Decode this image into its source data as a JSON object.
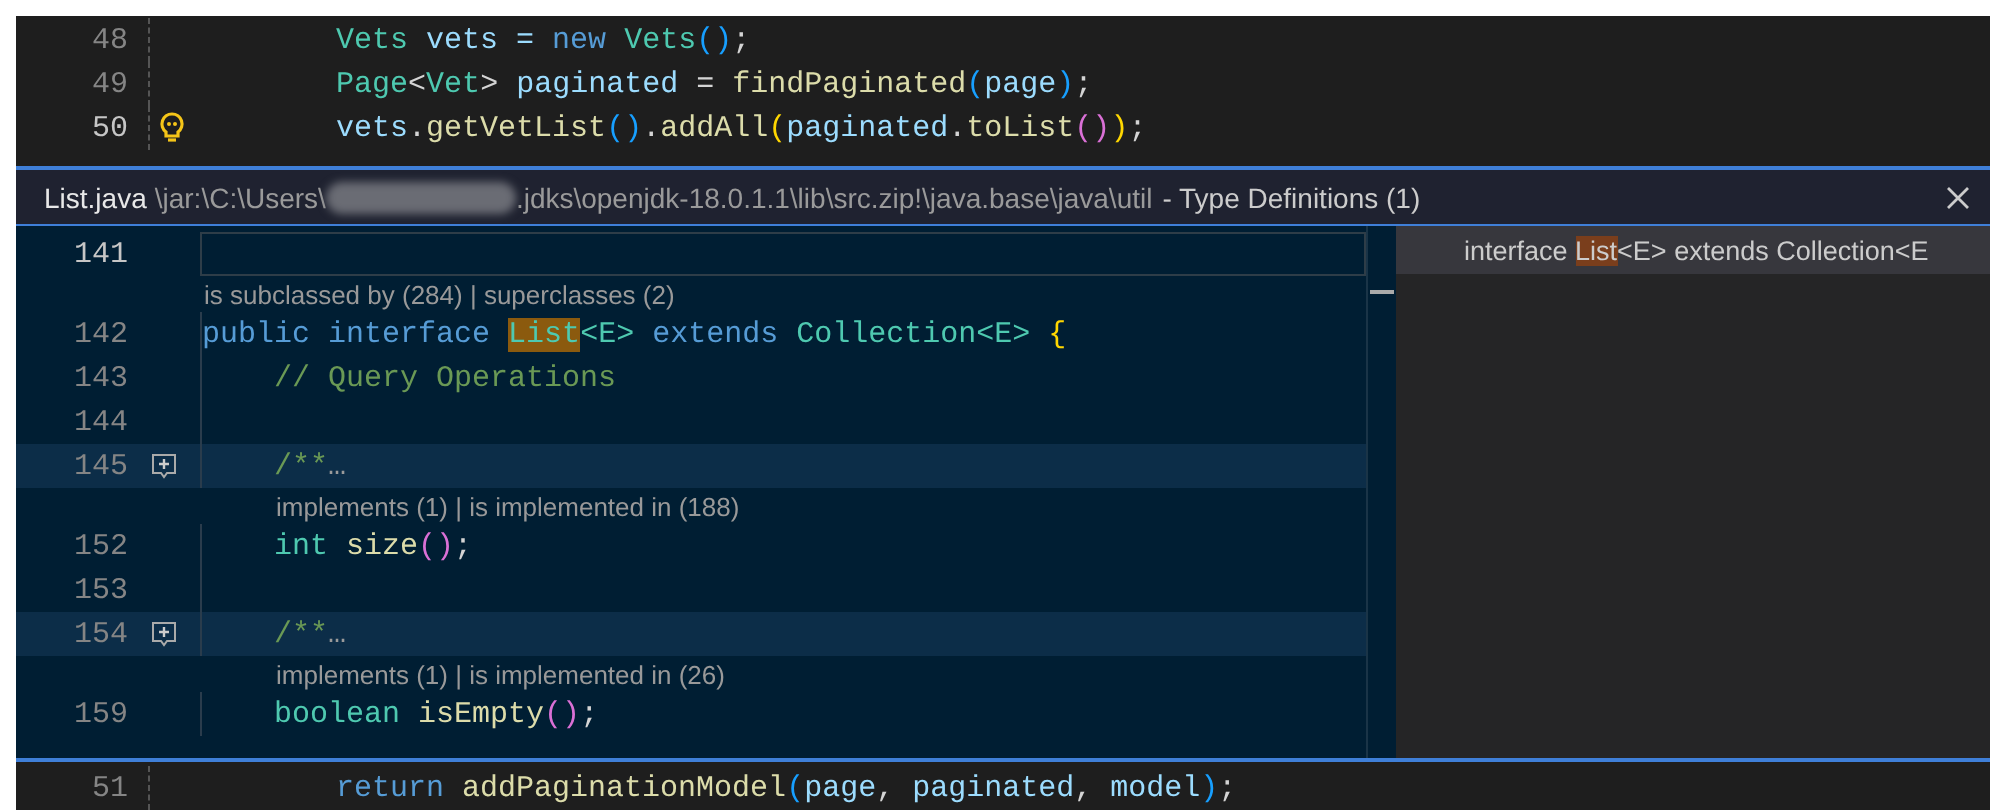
{
  "editor_top": {
    "lines": [
      {
        "number": "48",
        "bulb": false,
        "tokens": [
          {
            "text": "        Vets",
            "kind": "type"
          },
          {
            "text": " vets = ",
            "kind": "var"
          },
          {
            "text": "new",
            "kind": "keyword"
          },
          {
            "text": " Vets",
            "kind": "type"
          },
          {
            "text": "()",
            "kind": "bracket3"
          },
          {
            "text": ";",
            "kind": "plain"
          }
        ]
      },
      {
        "number": "49",
        "bulb": false,
        "tokens": [
          {
            "text": "        Page",
            "kind": "type"
          },
          {
            "text": "<",
            "kind": "plain"
          },
          {
            "text": "Vet",
            "kind": "type"
          },
          {
            "text": "> ",
            "kind": "plain"
          },
          {
            "text": "paginated",
            "kind": "var"
          },
          {
            "text": " = ",
            "kind": "plain"
          },
          {
            "text": "findPaginated",
            "kind": "func"
          },
          {
            "text": "(",
            "kind": "bracket3"
          },
          {
            "text": "page",
            "kind": "var"
          },
          {
            "text": ")",
            "kind": "bracket3"
          },
          {
            "text": ";",
            "kind": "plain"
          }
        ]
      },
      {
        "number": "50",
        "bulb": true,
        "tokens": [
          {
            "text": "        vets",
            "kind": "var"
          },
          {
            "text": ".",
            "kind": "plain"
          },
          {
            "text": "getVetList",
            "kind": "func"
          },
          {
            "text": "()",
            "kind": "bracket3"
          },
          {
            "text": ".",
            "kind": "plain"
          },
          {
            "text": "addAll",
            "kind": "func"
          },
          {
            "text": "(",
            "kind": "bracket1"
          },
          {
            "text": "paginated",
            "kind": "var"
          },
          {
            "text": ".",
            "kind": "plain"
          },
          {
            "text": "toList",
            "kind": "func"
          },
          {
            "text": "()",
            "kind": "bracket2"
          },
          {
            "text": ")",
            "kind": "bracket1"
          },
          {
            "text": ";",
            "kind": "plain"
          }
        ]
      }
    ]
  },
  "peek": {
    "header": {
      "file": "List.java",
      "path_start": "\\jar:\\C:\\Users\\",
      "path_end": ".jdks\\openjdk-18.0.1.1\\lib\\src.zip!\\java.base\\java\\util",
      "title": "- Type Definitions (1)"
    },
    "lines": [
      {
        "kind": "code",
        "number": "141",
        "current": true,
        "folded": false
      },
      {
        "kind": "codelens",
        "text": "is subclassed by (284) | superclasses (2)",
        "indented": false
      },
      {
        "kind": "code",
        "number": "142",
        "current": false,
        "folded": false,
        "tokens": [
          {
            "text": "public",
            "kind": "keyword"
          },
          {
            "text": " interface",
            "kind": "keyword"
          },
          {
            "text": " List",
            "kind": "match"
          },
          {
            "text": "<E>",
            "kind": "type"
          },
          {
            "text": " extends",
            "kind": "keyword"
          },
          {
            "text": " Collection",
            "kind": "type"
          },
          {
            "text": "<E>",
            "kind": "type"
          },
          {
            "text": " {",
            "kind": "bracket1"
          }
        ]
      },
      {
        "kind": "code",
        "number": "143",
        "current": false,
        "folded": false,
        "tokens": [
          {
            "text": "    // Query Operations",
            "kind": "comment"
          }
        ]
      },
      {
        "kind": "code",
        "number": "144",
        "current": false,
        "folded": false
      },
      {
        "kind": "code",
        "number": "145",
        "current": false,
        "folded": true,
        "tokens": [
          {
            "text": "    /**",
            "kind": "comment"
          },
          {
            "text": "…",
            "kind": "ellipsis"
          }
        ]
      },
      {
        "kind": "codelens",
        "text": "implements (1) | is implemented in (188)",
        "indented": true
      },
      {
        "kind": "code",
        "number": "152",
        "current": false,
        "folded": false,
        "tokens": [
          {
            "text": "    int",
            "kind": "type"
          },
          {
            "text": " size",
            "kind": "func"
          },
          {
            "text": "()",
            "kind": "bracket2"
          },
          {
            "text": ";",
            "kind": "plain"
          }
        ]
      },
      {
        "kind": "code",
        "number": "153",
        "current": false,
        "folded": false
      },
      {
        "kind": "code",
        "number": "154",
        "current": false,
        "folded": true,
        "tokens": [
          {
            "text": "    /**",
            "kind": "comment"
          },
          {
            "text": "…",
            "kind": "ellipsis"
          }
        ]
      },
      {
        "kind": "codelens",
        "text": "implements (1) | is implemented in (26)",
        "indented": true
      },
      {
        "kind": "code",
        "number": "159",
        "current": false,
        "folded": false,
        "tokens": [
          {
            "text": "    boolean",
            "kind": "type"
          },
          {
            "text": " isEmpty",
            "kind": "func"
          },
          {
            "text": "()",
            "kind": "bracket2"
          },
          {
            "text": ";",
            "kind": "plain"
          }
        ]
      }
    ],
    "references": [
      {
        "selected": true,
        "tokens": [
          {
            "text": "interface ",
            "kind": "plain"
          },
          {
            "text": "List",
            "kind": "match"
          },
          {
            "text": "<E> extends Collection<E",
            "kind": "plain"
          }
        ]
      }
    ]
  },
  "editor_bottom": {
    "lines": [
      {
        "number": "51",
        "bulb": false,
        "tokens": [
          {
            "text": "        return",
            "kind": "keyword"
          },
          {
            "text": " addPaginationModel",
            "kind": "func"
          },
          {
            "text": "(",
            "kind": "bracket3"
          },
          {
            "text": "page",
            "kind": "var"
          },
          {
            "text": ", ",
            "kind": "plain"
          },
          {
            "text": "paginated",
            "kind": "var"
          },
          {
            "text": ", ",
            "kind": "plain"
          },
          {
            "text": "model",
            "kind": "var"
          },
          {
            "text": ")",
            "kind": "bracket3"
          },
          {
            "text": ";",
            "kind": "plain"
          }
        ]
      }
    ]
  }
}
